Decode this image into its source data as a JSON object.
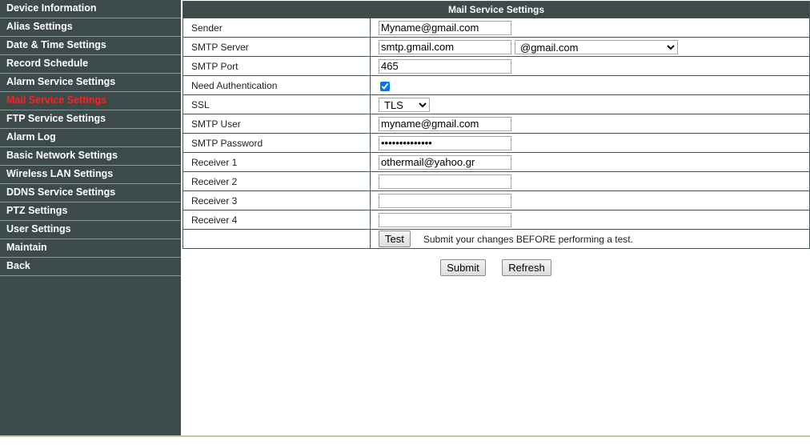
{
  "sidebar": {
    "items": [
      {
        "label": "Device Information"
      },
      {
        "label": "Alias Settings"
      },
      {
        "label": "Date & Time Settings"
      },
      {
        "label": "Record Schedule"
      },
      {
        "label": "Alarm Service Settings"
      },
      {
        "label": "Mail Service Settings"
      },
      {
        "label": "FTP Service Settings"
      },
      {
        "label": "Alarm Log"
      },
      {
        "label": "Basic Network Settings"
      },
      {
        "label": "Wireless LAN Settings"
      },
      {
        "label": "DDNS Service Settings"
      },
      {
        "label": "PTZ Settings"
      },
      {
        "label": "User Settings"
      },
      {
        "label": "Maintain"
      },
      {
        "label": "Back"
      }
    ],
    "active_item": "Mail Service Settings",
    "active_color": "#ff2020",
    "background": "#3c4a4a"
  },
  "form": {
    "title": "Mail Service Settings",
    "sender": {
      "label": "Sender",
      "value": "Myname@gmail.com"
    },
    "smtp_server": {
      "label": "SMTP Server",
      "value": "smtp.gmail.com",
      "domain_selected": "@gmail.com"
    },
    "smtp_port": {
      "label": "SMTP Port",
      "value": "465"
    },
    "need_auth": {
      "label": "Need Authentication",
      "checked": true
    },
    "ssl": {
      "label": "SSL",
      "selected": "TLS"
    },
    "smtp_user": {
      "label": "SMTP User",
      "value": "myname@gmail.com"
    },
    "smtp_password": {
      "label": "SMTP Password",
      "value": "••••••••••••••"
    },
    "receiver1": {
      "label": "Receiver 1",
      "value": "othermail@yahoo.gr"
    },
    "receiver2": {
      "label": "Receiver 2",
      "value": ""
    },
    "receiver3": {
      "label": "Receiver 3",
      "value": ""
    },
    "receiver4": {
      "label": "Receiver 4",
      "value": ""
    },
    "test_button": "Test",
    "test_hint": "Submit your changes BEFORE performing a test."
  },
  "actions": {
    "submit": "Submit",
    "refresh": "Refresh"
  }
}
